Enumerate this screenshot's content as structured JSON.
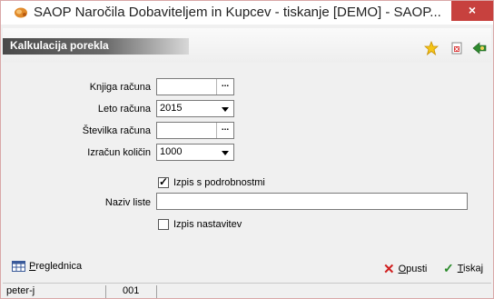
{
  "window": {
    "title": "SAOP   Naročila Dobaviteljem in Kupcev - tiskanje [DEMO] - SAOP...",
    "close_label": "×"
  },
  "header": {
    "caption": "Kalkulacija porekla",
    "icons": [
      "star-icon",
      "exit-doc-icon",
      "help-arrow-icon"
    ]
  },
  "form": {
    "knjiga_label": "Knjiga računa",
    "knjiga_value": "",
    "leto_label": "Leto računa",
    "leto_value": "2015",
    "stevilka_label": "Številka računa",
    "stevilka_value": "",
    "izracun_label": "Izračun količin",
    "izracun_value": "1000",
    "podrobnosti_label": "Izpis s podrobnostmi",
    "podrobnosti_checked": true,
    "naziv_label": "Naziv liste",
    "naziv_value": "",
    "nastavitev_label": "Izpis nastavitev",
    "nastavitev_checked": false,
    "dots": "..."
  },
  "toolbar": {
    "preglednica_label": "Preglednica",
    "opusti_label": "Opusti",
    "tiskaj_label": "Tiskaj"
  },
  "status": {
    "user": "peter-j",
    "code": "001"
  },
  "colors": {
    "close_bg": "#c7413e",
    "caption_band": "#4a4a4a",
    "cancel_x": "#d02020",
    "confirm_check": "#2a8a2a"
  }
}
